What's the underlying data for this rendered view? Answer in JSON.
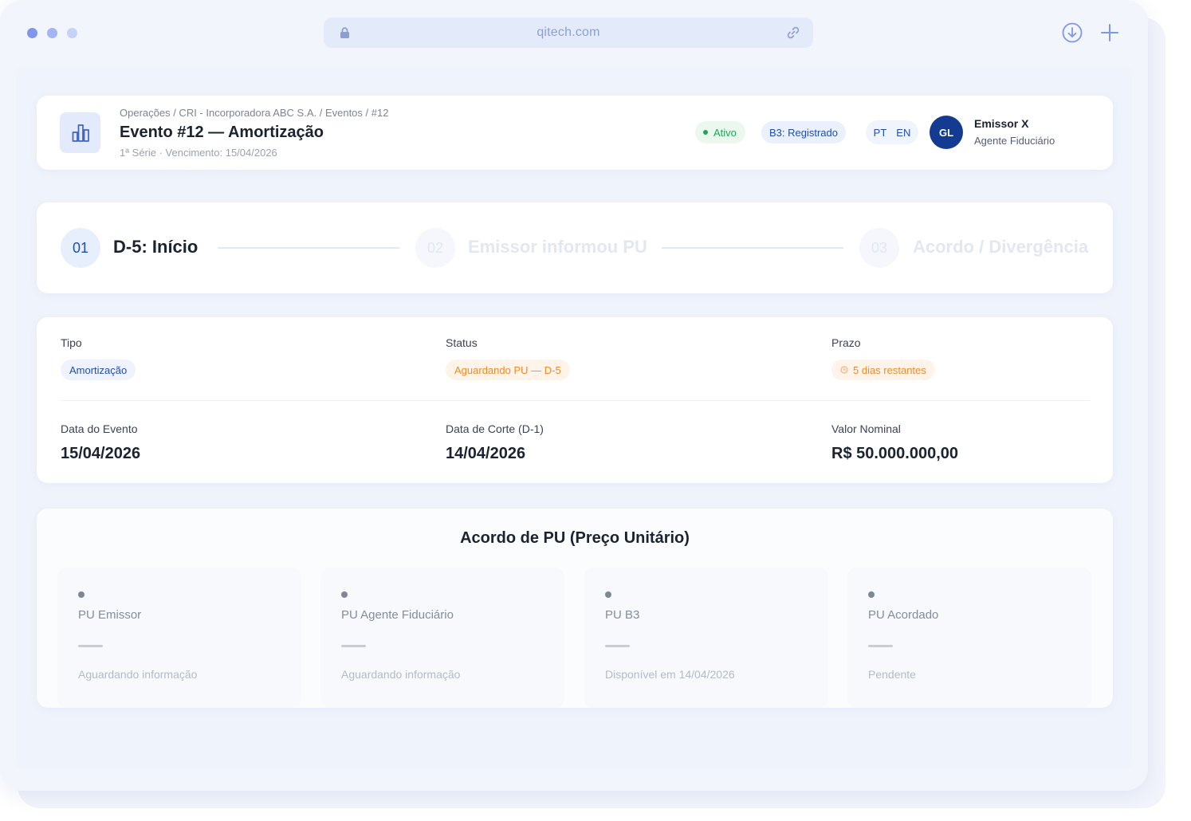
{
  "browser": {
    "url": "qitech.com",
    "icons": [
      "lock-icon",
      "link-icon",
      "download-icon",
      "plus-icon"
    ]
  },
  "header": {
    "breadcrumb": "Operações / CRI - Incorporadora ABC S.A. / Eventos / #12",
    "title": "Evento #12 — Amortização",
    "subtitle": "1ª Série · Vencimento: 15/04/2026",
    "status_badge": "Ativo",
    "b3_badge": "B3: Registrado",
    "languages": [
      "PT",
      "EN"
    ],
    "user": {
      "initials": "GL",
      "name": "Emissor X",
      "role": "Agente Fiduciário"
    }
  },
  "stepper": {
    "steps": [
      {
        "number": "01",
        "label": "D-5: Início",
        "state": "active"
      },
      {
        "number": "02",
        "label": "Emissor informou PU",
        "state": "pending"
      },
      {
        "number": "03",
        "label": "Acordo / Divergência",
        "state": "pending"
      }
    ]
  },
  "info": {
    "tipo": {
      "label": "Tipo",
      "value": "Amortização"
    },
    "status": {
      "label": "Status",
      "value": "Aguardando PU — D-5"
    },
    "prazo": {
      "label": "Prazo",
      "value": "5 dias restantes"
    },
    "data_evento": {
      "label": "Data do Evento",
      "value": "15/04/2026"
    },
    "data_corte": {
      "label": "Data de Corte (D-1)",
      "value": "14/04/2026"
    },
    "valor_nominal": {
      "label": "Valor Nominal",
      "value": "R$ 50.000.000,00"
    }
  },
  "pu": {
    "title": "Acordo de PU (Preço Unitário)",
    "boxes": [
      {
        "label": "PU Emissor",
        "value": "—",
        "status": "Aguardando informação"
      },
      {
        "label": "PU Agente Fiduciário",
        "value": "—",
        "status": "Aguardando informação"
      },
      {
        "label": "PU B3",
        "value": "—",
        "status": "Disponível em 14/04/2026"
      },
      {
        "label": "PU Acordado",
        "value": "—",
        "status": "Pendente"
      }
    ]
  },
  "colors": {
    "accent": "#1f4fa6",
    "avatar": "#123b91",
    "success": "#22a356",
    "warning": "#f08a24",
    "background": "#f2f5fc"
  }
}
